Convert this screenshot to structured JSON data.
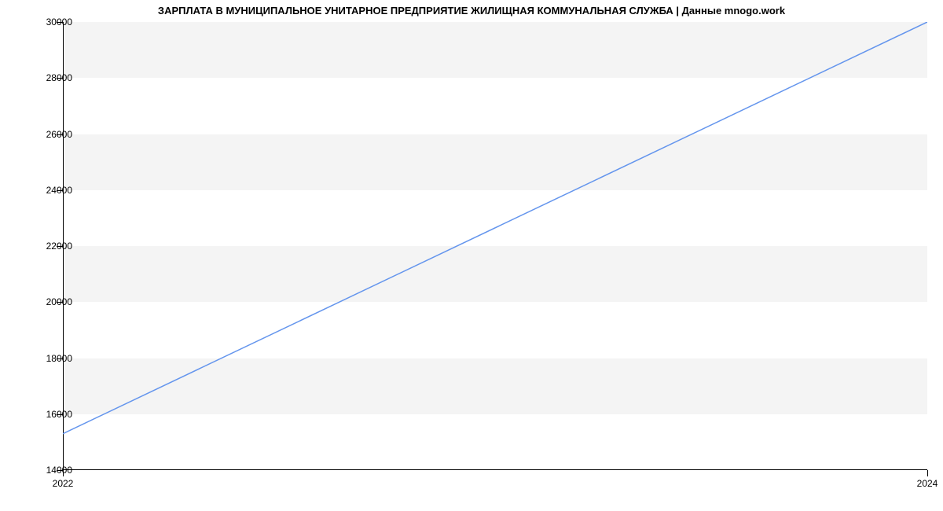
{
  "chart_data": {
    "type": "line",
    "title": "ЗАРПЛАТА В МУНИЦИПАЛЬНОЕ УНИТАРНОЕ ПРЕДПРИЯТИЕ ЖИЛИЩНАЯ КОММУНАЛЬНАЯ СЛУЖБА | Данные mnogo.work",
    "x": [
      2022,
      2024
    ],
    "values": [
      15300,
      30000
    ],
    "xlabel": "",
    "ylabel": "",
    "x_ticks": [
      2022,
      2024
    ],
    "y_ticks": [
      14000,
      16000,
      18000,
      20000,
      22000,
      24000,
      26000,
      28000,
      30000
    ],
    "xlim": [
      2022,
      2024
    ],
    "ylim": [
      14000,
      30000
    ],
    "line_color": "#6495ed",
    "grid": "horizontal-bands"
  }
}
